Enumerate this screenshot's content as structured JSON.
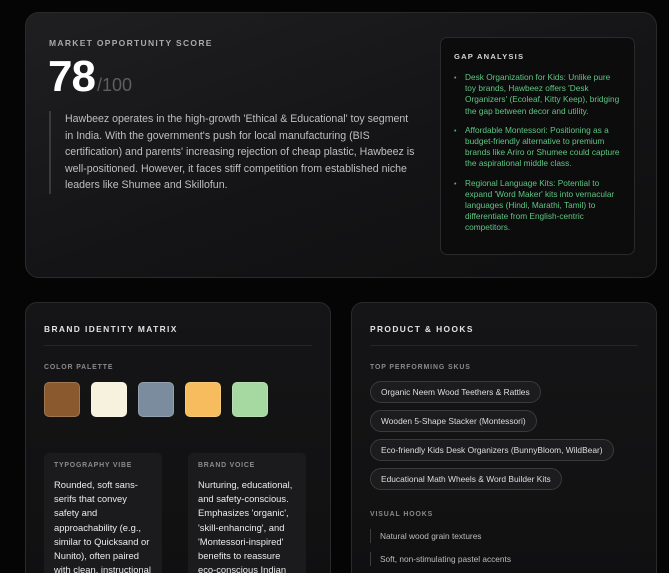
{
  "score": {
    "label": "MARKET OPPORTUNITY SCORE",
    "value": "78",
    "max": "/100",
    "description": "Hawbeez operates in the high-growth 'Ethical & Educational' toy segment in India. With the government's push for local manufacturing (BIS certification) and parents' increasing rejection of cheap plastic, Hawbeez is well-positioned. However, it faces stiff competition from established niche leaders like Shumee and Skillofun."
  },
  "gap_analysis": {
    "title": "GAP ANALYSIS",
    "items": [
      "Desk Organization for Kids: Unlike pure toy brands, Hawbeez offers 'Desk Organizers' (Ecoleaf, Kitty Keep), bridging the gap between decor and utility.",
      "Affordable Montessori: Positioning as a budget-friendly alternative to premium brands like Ariro or Shumee could capture the aspirational middle class.",
      "Regional Language Kits: Potential to expand 'Word Maker' kits into vernacular languages (Hindi, Marathi, Tamil) to differentiate from English-centric competitors."
    ],
    "accent_color": "#5ec682"
  },
  "brand_identity": {
    "title": "BRAND IDENTITY MATRIX",
    "palette_label": "COLOR PALETTE",
    "palette": [
      "#8a5a2e",
      "#f6f2de",
      "#7a8c9e",
      "#f6bc5d",
      "#a6d9a2"
    ],
    "typography_label": "TYPOGRAPHY VIBE",
    "typography_text": "Rounded, soft sans-serifs that convey safety and approachability (e.g., similar to Quicksand or Nunito), often paired with clean, instructional",
    "voice_label": "BRAND VOICE",
    "voice_text": "Nurturing, educational, and safety-conscious. Emphasizes 'organic', 'skill-enhancing', and 'Montessori-inspired' benefits to reassure eco-conscious Indian"
  },
  "product_hooks": {
    "title": "PRODUCT & HOOKS",
    "skus_label": "TOP PERFORMING SKUS",
    "skus": [
      "Organic Neem Wood Teethers & Rattles",
      "Wooden 5-Shape Stacker (Montessori)",
      "Eco-friendly Kids Desk Organizers (BunnyBloom, WildBear)",
      "Educational Math Wheels & Word Builder Kits"
    ],
    "hooks_label": "VISUAL HOOKS",
    "hooks": [
      "Natural wood grain textures",
      "Soft, non-stimulating pastel accents"
    ]
  }
}
